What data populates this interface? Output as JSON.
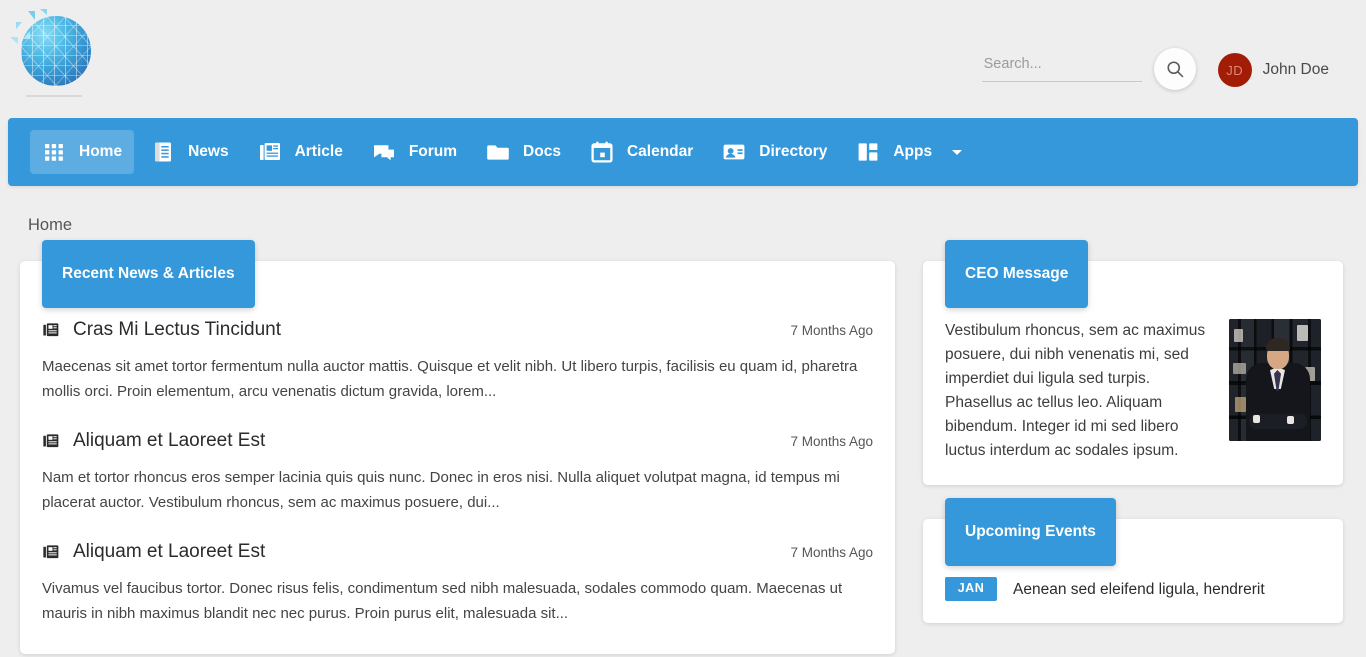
{
  "brand": {
    "logo_alt": "globe-logo"
  },
  "header": {
    "search": {
      "placeholder": "Search...",
      "value": ""
    },
    "search_button_label": "search-icon",
    "user": {
      "initials": "JD",
      "name": "John Doe"
    }
  },
  "nav": {
    "items": [
      {
        "label": "Home",
        "icon": "grid-icon",
        "active": true,
        "dropdown": false
      },
      {
        "label": "News",
        "icon": "document-icon",
        "active": false,
        "dropdown": false
      },
      {
        "label": "Article",
        "icon": "newspaper-icon",
        "active": false,
        "dropdown": false
      },
      {
        "label": "Forum",
        "icon": "chat-icon",
        "active": false,
        "dropdown": false
      },
      {
        "label": "Docs",
        "icon": "folder-icon",
        "active": false,
        "dropdown": false
      },
      {
        "label": "Calendar",
        "icon": "calendar-icon",
        "active": false,
        "dropdown": false
      },
      {
        "label": "Directory",
        "icon": "contact-card-icon",
        "active": false,
        "dropdown": false
      },
      {
        "label": "Apps",
        "icon": "dashboard-icon",
        "active": false,
        "dropdown": true
      }
    ]
  },
  "breadcrumb": {
    "current": "Home"
  },
  "news_panel": {
    "title": "Recent News & Articles",
    "articles": [
      {
        "title": "Cras Mi Lectus Tincidunt",
        "date": "7 Months Ago",
        "excerpt": "Maecenas sit amet tortor fermentum nulla auctor mattis. Quisque et velit nibh. Ut libero turpis, facilisis eu quam id, pharetra mollis orci. Proin elementum, arcu venenatis dictum gravida, lorem..."
      },
      {
        "title": "Aliquam et Laoreet Est",
        "date": "7 Months Ago",
        "excerpt": " Nam et tortor rhoncus eros semper lacinia quis quis nunc. Donec in eros nisi. Nulla aliquet volutpat magna, id tempus mi placerat auctor. Vestibulum rhoncus, sem ac maximus posuere, dui..."
      },
      {
        "title": "Aliquam et Laoreet Est",
        "date": "7 Months Ago",
        "excerpt": "Vivamus vel faucibus tortor. Donec risus felis, condimentum sed nibh malesuada, sodales commodo quam. Maecenas ut mauris in nibh maximus blandit nec nec purus. Proin purus elit, malesuada sit..."
      }
    ]
  },
  "ceo_panel": {
    "title": "CEO Message",
    "message": "Vestibulum rhoncus, sem ac maximus posuere, dui nibh venenatis mi, sed imperdiet dui ligula sed turpis. Phasellus ac tellus leo. Aliquam bibendum. Integer id mi sed libero luctus interdum ac sodales ipsum.",
    "photo_alt": "ceo-portrait"
  },
  "events_panel": {
    "title": "Upcoming Events",
    "events": [
      {
        "month": "JAN",
        "title": "Aenean sed eleifend ligula, hendrerit"
      }
    ]
  },
  "colors": {
    "accent": "#3498db",
    "accent_active": "#5dade2",
    "page_bg": "#eeeeee",
    "card_bg": "#ffffff",
    "avatar_bg": "#a31d06"
  }
}
